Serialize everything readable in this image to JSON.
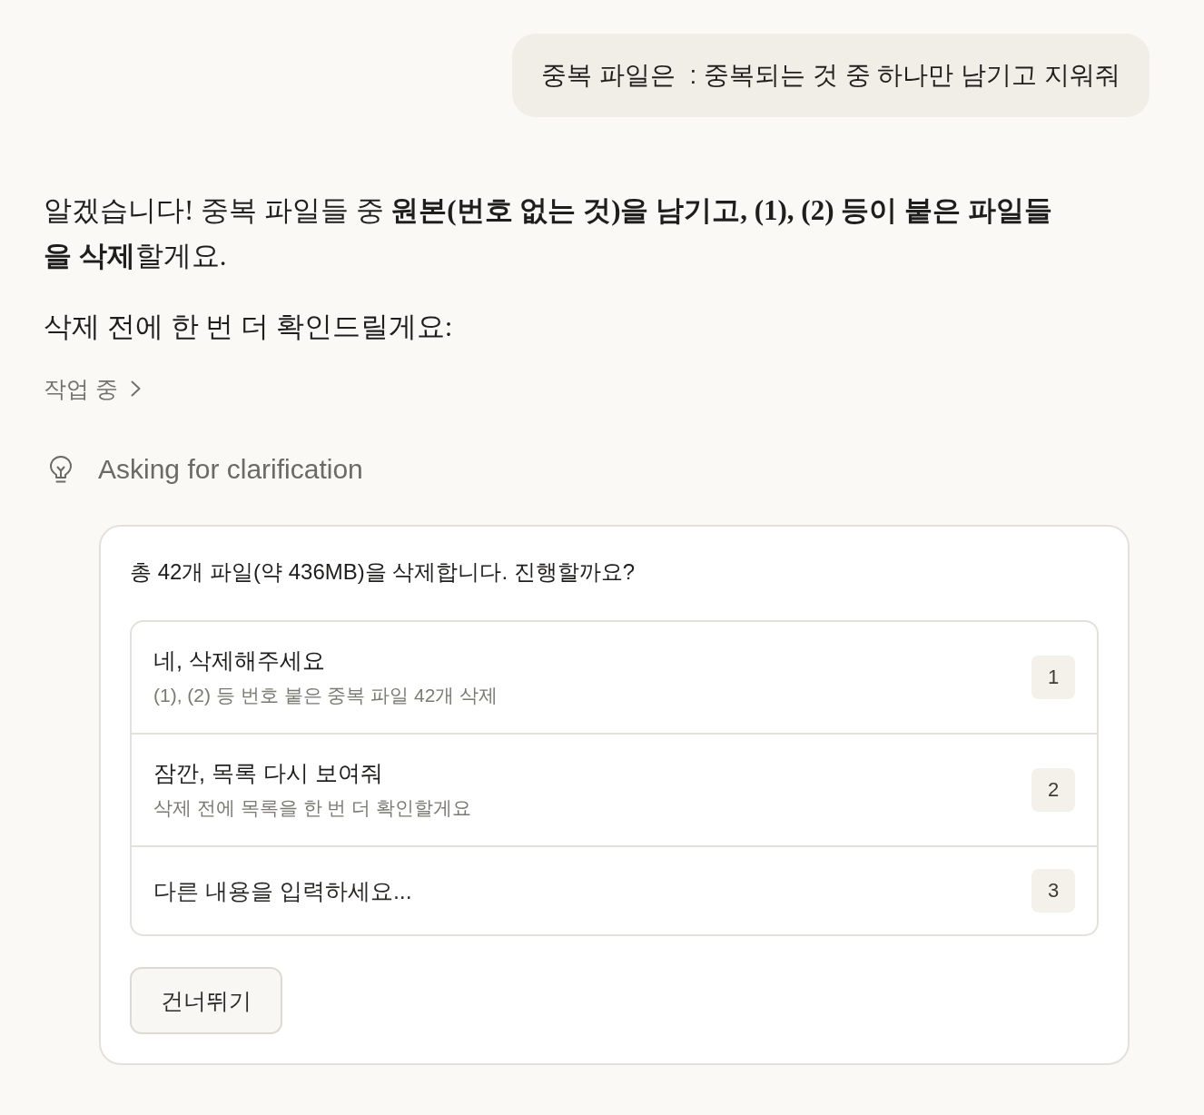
{
  "user_message": {
    "text": "중복 파일은  : 중복되는 것 중 하나만 남기고 지워줘"
  },
  "assistant_message": {
    "paragraphs": [
      "알겠습니다! 중복 파일들 중 **원본(번호 없는 것)을 남기고, (1), (2) 등이 붙은 파일들을 삭제**할게요.",
      "삭제 전에 한 번 더 확인드릴게요:"
    ]
  },
  "activity_toggle": {
    "label": "작업 중",
    "expanded": false
  },
  "status": {
    "label": "Asking for clarification"
  },
  "question_card": {
    "question": "총 42개 파일(약 436MB)을 삭제합니다. 진행할까요?",
    "options": [
      {
        "kind": "choice",
        "title": "네, 삭제해주세요",
        "description": "(1), (2) 등 번호 붙은 중복 파일 42개 삭제",
        "shortcut": "1"
      },
      {
        "kind": "choice",
        "title": "잠깐, 목록 다시 보여줘",
        "description": "삭제 전에 목록을 한 번 더 확인할게요",
        "shortcut": "2"
      },
      {
        "kind": "input",
        "placeholder": "다른 내용을 입력하세요...",
        "shortcut": "3"
      }
    ],
    "skip_button": "건너뛰기"
  }
}
